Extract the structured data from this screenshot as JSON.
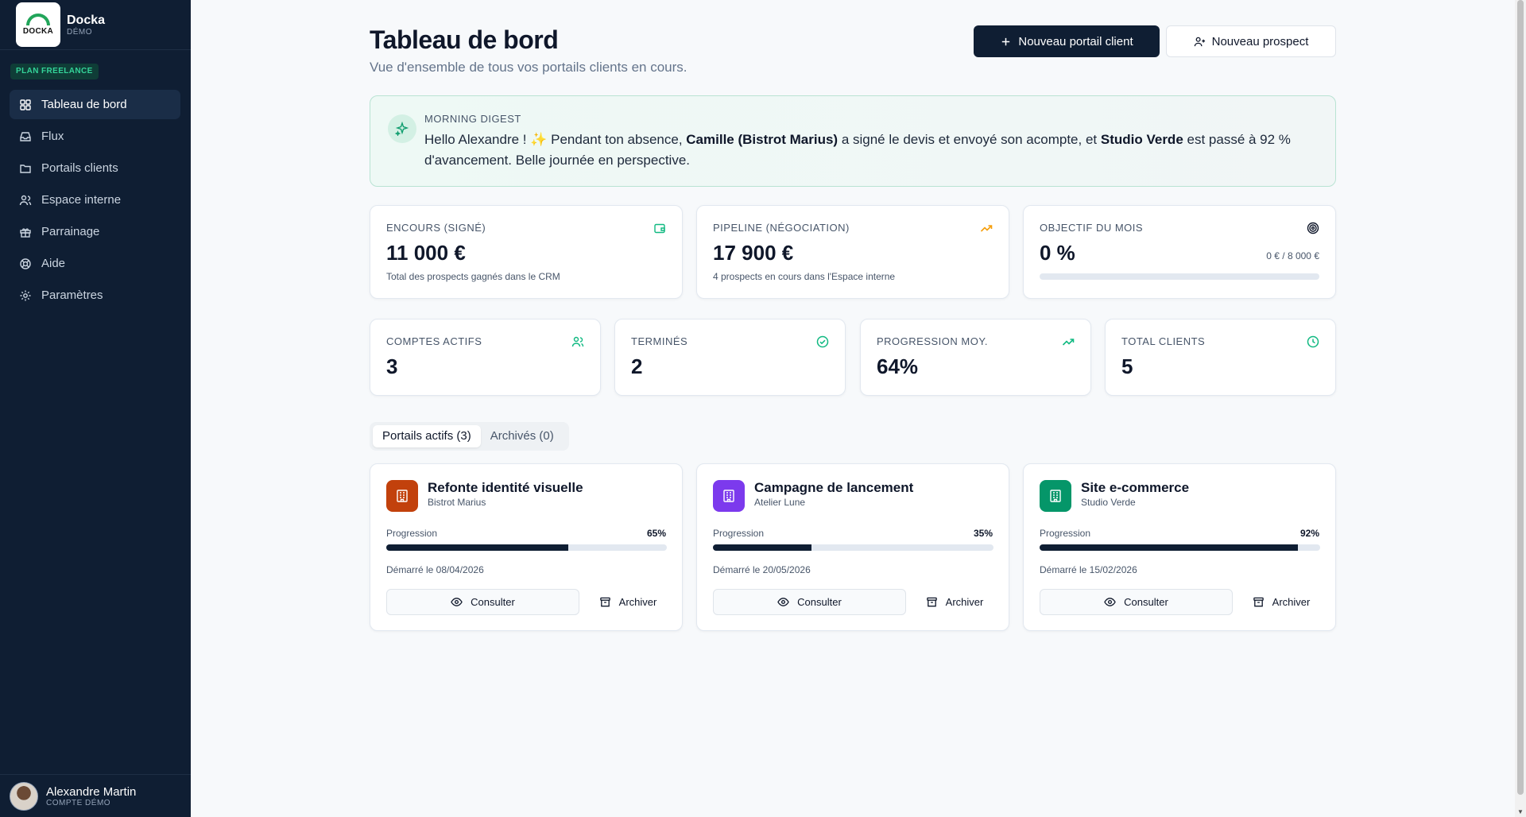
{
  "brand": {
    "logo_text": "DOCKA",
    "name": "Docka",
    "sub": "DÉMO"
  },
  "plan_badge": "PLAN FREELANCE",
  "nav": [
    {
      "label": "Tableau de bord",
      "icon": "grid-icon",
      "active": true
    },
    {
      "label": "Flux",
      "icon": "inbox-icon"
    },
    {
      "label": "Portails clients",
      "icon": "folder-icon"
    },
    {
      "label": "Espace interne",
      "icon": "users-icon"
    },
    {
      "label": "Parrainage",
      "icon": "gift-icon"
    },
    {
      "label": "Aide",
      "icon": "lifebuoy-icon"
    },
    {
      "label": "Paramètres",
      "icon": "gear-icon"
    }
  ],
  "user": {
    "name": "Alexandre Martin",
    "sub": "COMPTE DÉMO"
  },
  "header": {
    "title": "Tableau de bord",
    "subtitle": "Vue d'ensemble de tous vos portails clients en cours.",
    "primary_button": "Nouveau portail client",
    "secondary_button": "Nouveau prospect"
  },
  "digest": {
    "label": "MORNING DIGEST",
    "text_1": "Hello Alexandre ! ✨ Pendant ton absence, ",
    "bold_1": "Camille (Bistrot Marius)",
    "text_2": " a signé le devis et envoyé son acompte, et ",
    "bold_2": "Studio Verde",
    "text_3": " est passé à 92 % d'avancement. Belle journée en perspective."
  },
  "kpis": {
    "encours": {
      "label": "ENCOURS (SIGNÉ)",
      "value": "11 000 €",
      "sub": "Total des prospects gagnés dans le CRM",
      "icon": "wallet-icon",
      "color": "#10b981"
    },
    "pipeline": {
      "label": "PIPELINE (NÉGOCIATION)",
      "value": "17 900 €",
      "sub": "4 prospects en cours dans l'Espace interne",
      "icon": "trending-up-icon",
      "color": "#f59e0b"
    },
    "objectif": {
      "label": "OBJECTIF DU MOIS",
      "value": "0 %",
      "target": "0 € / 8 000 €",
      "progress": 0,
      "icon": "target-icon",
      "color": "#0f172a"
    }
  },
  "stats": [
    {
      "label": "COMPTES ACTIFS",
      "value": "3",
      "icon": "users-icon",
      "color": "#10b981"
    },
    {
      "label": "TERMINÉS",
      "value": "2",
      "icon": "check-circle-icon",
      "color": "#10b981"
    },
    {
      "label": "PROGRESSION MOY.",
      "value": "64%",
      "icon": "trending-up-icon",
      "color": "#10b981"
    },
    {
      "label": "TOTAL CLIENTS",
      "value": "5",
      "icon": "clock-icon",
      "color": "#10b981"
    }
  ],
  "tabs": [
    {
      "label": "Portails actifs (3)",
      "active": true
    },
    {
      "label": "Archivés (0)",
      "active": false
    }
  ],
  "portals": [
    {
      "title": "Refonte identité visuelle",
      "client": "Bistrot Marius",
      "progress_label": "Progression",
      "progress_text": "65%",
      "progress": 65,
      "date": "Démarré le 08/04/2026",
      "view": "Consulter",
      "archive": "Archiver",
      "color": "#c2410c"
    },
    {
      "title": "Campagne de lancement",
      "client": "Atelier Lune",
      "progress_label": "Progression",
      "progress_text": "35%",
      "progress": 35,
      "date": "Démarré le 20/05/2026",
      "view": "Consulter",
      "archive": "Archiver",
      "color": "#7c3aed"
    },
    {
      "title": "Site e-commerce",
      "client": "Studio Verde",
      "progress_label": "Progression",
      "progress_text": "92%",
      "progress": 92,
      "date": "Démarré le 15/02/2026",
      "view": "Consulter",
      "archive": "Archiver",
      "color": "#059669"
    }
  ]
}
